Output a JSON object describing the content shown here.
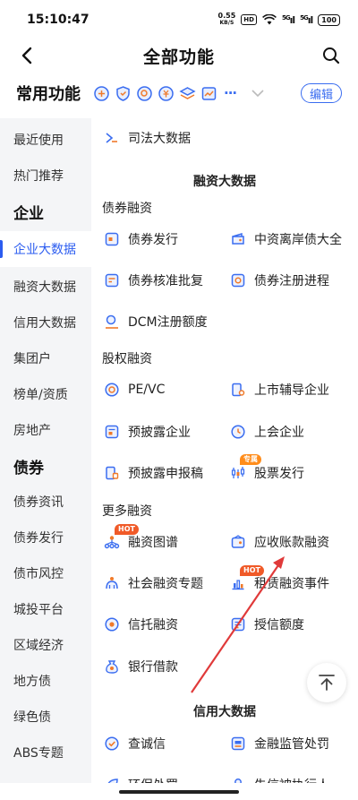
{
  "status": {
    "time": "15:10:47",
    "net_speed_value": "0.55",
    "net_speed_unit": "KB/S",
    "hd": "HD",
    "signal1": "5G",
    "signal2": "5G",
    "battery": "100"
  },
  "nav": {
    "title": "全部功能"
  },
  "favorites": {
    "title": "常用功能",
    "more": "···",
    "edit_label": "编辑"
  },
  "sidebar": {
    "items": [
      {
        "label": "最近使用"
      },
      {
        "label": "热门推荐"
      },
      {
        "label": "企业"
      },
      {
        "label": "企业大数据"
      },
      {
        "label": "融资大数据"
      },
      {
        "label": "信用大数据"
      },
      {
        "label": "集团户"
      },
      {
        "label": "榜单/资质"
      },
      {
        "label": "房地产"
      },
      {
        "label": "债券"
      },
      {
        "label": "债券资讯"
      },
      {
        "label": "债券发行"
      },
      {
        "label": "债市风控"
      },
      {
        "label": "城投平台"
      },
      {
        "label": "区域经济"
      },
      {
        "label": "地方债"
      },
      {
        "label": "绿色债"
      },
      {
        "label": "ABS专题"
      }
    ]
  },
  "content": {
    "top_item": "司法大数据",
    "financing": {
      "title": "融资大数据",
      "bond_group": "债券融资",
      "bond_items": [
        "债券发行",
        "中资离岸债大全",
        "债券核准批复",
        "债券注册进程",
        "DCM注册额度"
      ],
      "equity_group": "股权融资",
      "equity_items": [
        "PE/VC",
        "上市辅导企业",
        "预披露企业",
        "上会企业",
        "预披露申报稿",
        "股票发行"
      ],
      "more_group": "更多融资",
      "more_items": [
        "融资图谱",
        "应收账款融资",
        "社会融资专题",
        "租赁融资事件",
        "信托融资",
        "授信额度",
        "银行借款"
      ]
    },
    "credit": {
      "title": "信用大数据",
      "items": [
        "查诚信",
        "金融监管处罚",
        "环保处罚",
        "失信被执行人"
      ]
    },
    "badges": {
      "hot": "HOT",
      "exclusive": "专属"
    }
  }
}
